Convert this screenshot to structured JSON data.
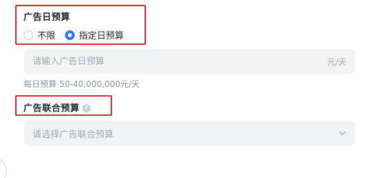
{
  "daily_budget": {
    "title": "广告日预算",
    "options": [
      {
        "label": "不限",
        "checked": false
      },
      {
        "label": "指定日预算",
        "checked": true
      }
    ],
    "input_placeholder": "请输入广告日预算",
    "unit": "元/天",
    "hint": "每日预算 50-40,000,000元/天"
  },
  "joint_budget": {
    "title": "广告联合预算",
    "help_icon": "question-circle-icon",
    "select_placeholder": "请选择广告联合预算",
    "dropdown_icon": "chevron-down-icon"
  },
  "colors": {
    "accent": "#3370ff",
    "annotation": "#e0232a",
    "field_bg": "#f2f3f5"
  }
}
